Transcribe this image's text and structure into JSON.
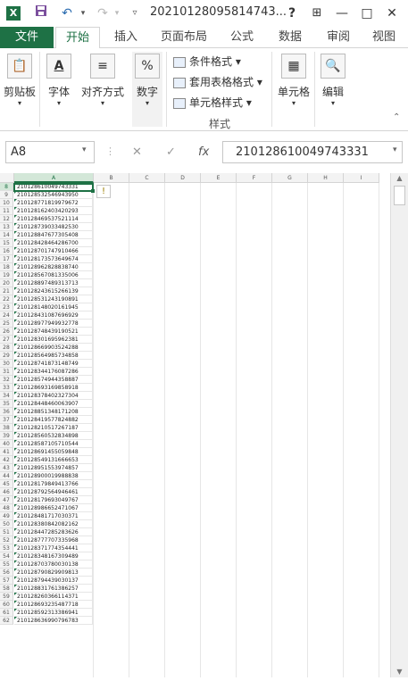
{
  "window": {
    "title": "20210128095814743...",
    "help": "?",
    "minimize": "—",
    "restore": "□",
    "close": "✕",
    "ribbon_display": "⊞"
  },
  "quick_access": {
    "save_icon": "save-icon",
    "undo_icon": "undo-icon",
    "redo_icon": "redo-icon"
  },
  "tabs": [
    "文件",
    "开始",
    "插入",
    "页面布局",
    "公式",
    "数据",
    "审阅",
    "视图"
  ],
  "ribbon": {
    "clipboard": "剪贴板",
    "font": "字体",
    "alignment": "对齐方式",
    "number": "数字",
    "conditional": "条件格式",
    "table_format": "套用表格格式",
    "cell_style": "单元格样式",
    "styles_group": "样式",
    "cells": "单元格",
    "editing": "编辑"
  },
  "formula_bar": {
    "name_box": "A8",
    "cancel": "✕",
    "enter": "✓",
    "fx": "fx",
    "value": "210128610049743331"
  },
  "columns": [
    "A",
    "B",
    "C",
    "D",
    "E",
    "F",
    "G",
    "H",
    "I"
  ],
  "rows": [
    {
      "n": "8",
      "v": "210128610049743331"
    },
    {
      "n": "9",
      "v": "210128532546943950"
    },
    {
      "n": "10",
      "v": "210128771819979672"
    },
    {
      "n": "11",
      "v": "210128162403420293"
    },
    {
      "n": "12",
      "v": "210128469537521114"
    },
    {
      "n": "13",
      "v": "210128739033482530"
    },
    {
      "n": "14",
      "v": "210128847677305408"
    },
    {
      "n": "15",
      "v": "210128428464286700"
    },
    {
      "n": "16",
      "v": "210128701747910466"
    },
    {
      "n": "17",
      "v": "210128173573649674"
    },
    {
      "n": "18",
      "v": "210128962828838740"
    },
    {
      "n": "19",
      "v": "210128567081335006"
    },
    {
      "n": "20",
      "v": "210128897489313713"
    },
    {
      "n": "21",
      "v": "210128243615266139"
    },
    {
      "n": "22",
      "v": "210128531243190891"
    },
    {
      "n": "23",
      "v": "210128148020161945"
    },
    {
      "n": "24",
      "v": "210128431087696929"
    },
    {
      "n": "25",
      "v": "210128977949932778"
    },
    {
      "n": "26",
      "v": "210128748439190521"
    },
    {
      "n": "27",
      "v": "210128301695962381"
    },
    {
      "n": "28",
      "v": "210128669903524288"
    },
    {
      "n": "29",
      "v": "210128564985734858"
    },
    {
      "n": "30",
      "v": "210128741873148749"
    },
    {
      "n": "31",
      "v": "210128344176087286"
    },
    {
      "n": "32",
      "v": "210128574944358887"
    },
    {
      "n": "33",
      "v": "210128693169858918"
    },
    {
      "n": "34",
      "v": "210128378402327304"
    },
    {
      "n": "35",
      "v": "210128448460063907"
    },
    {
      "n": "36",
      "v": "210128851348171208"
    },
    {
      "n": "37",
      "v": "210128419577824882"
    },
    {
      "n": "38",
      "v": "210128210517267187"
    },
    {
      "n": "39",
      "v": "210128560532834898"
    },
    {
      "n": "40",
      "v": "210128587105710544"
    },
    {
      "n": "41",
      "v": "210128691455059848"
    },
    {
      "n": "42",
      "v": "210128549131666653"
    },
    {
      "n": "43",
      "v": "210128951553974857"
    },
    {
      "n": "44",
      "v": "210128900019988838"
    },
    {
      "n": "45",
      "v": "210128179849413766"
    },
    {
      "n": "46",
      "v": "210128792564946461"
    },
    {
      "n": "47",
      "v": "210128179693049767"
    },
    {
      "n": "48",
      "v": "210128986652471067"
    },
    {
      "n": "49",
      "v": "210128481717030371"
    },
    {
      "n": "50",
      "v": "210128380842082162"
    },
    {
      "n": "51",
      "v": "210128447285283626"
    },
    {
      "n": "52",
      "v": "210128777707335968"
    },
    {
      "n": "53",
      "v": "210128371774354441"
    },
    {
      "n": "54",
      "v": "210128348167309489"
    },
    {
      "n": "55",
      "v": "210128703780030138"
    },
    {
      "n": "56",
      "v": "210128790829909813"
    },
    {
      "n": "57",
      "v": "210128794439030137"
    },
    {
      "n": "58",
      "v": "210128831761386257"
    },
    {
      "n": "59",
      "v": "210128260366114371"
    },
    {
      "n": "60",
      "v": "210128693235487718"
    },
    {
      "n": "61",
      "v": "210128592313386941"
    },
    {
      "n": "62",
      "v": "210128636990796783"
    }
  ],
  "scroll": {
    "up": "▲",
    "down": "▼"
  },
  "warning_icon": "warning-icon"
}
